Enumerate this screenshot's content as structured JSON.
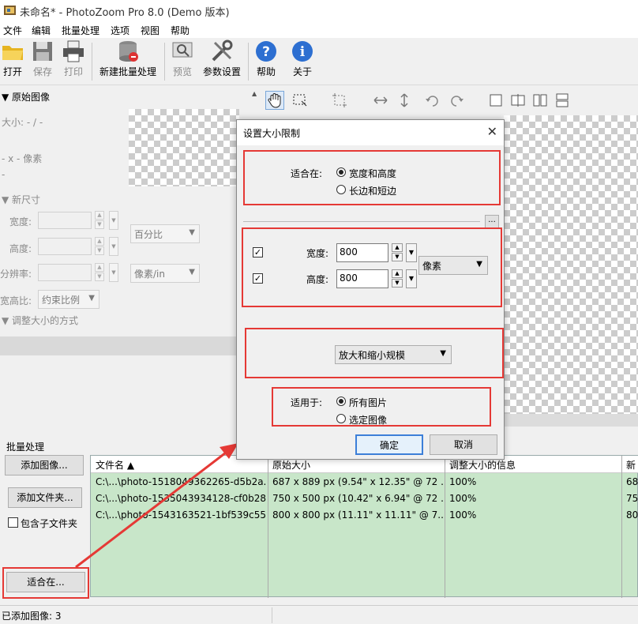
{
  "window": {
    "title": "未命名* - PhotoZoom Pro 8.0 (Demo 版本)"
  },
  "menu": [
    "文件",
    "编辑",
    "批量处理",
    "选项",
    "视图",
    "帮助"
  ],
  "toolbar": {
    "open": "打开",
    "save": "保存",
    "print": "打印",
    "new_batch": "新建批量处理",
    "preview": "预览",
    "settings": "参数设置",
    "help": "帮助",
    "about": "关于"
  },
  "left": {
    "original_header": "▼ 原始图像",
    "size_line": "大小: - / -",
    "px_line": "- x - 像素",
    "dash": "-",
    "new_size_header": "▼ 新尺寸",
    "width_label": "宽度:",
    "height_label": "高度:",
    "resolution_label": "分辨率:",
    "ratio_label": "宽高比:",
    "unit_combo": "百分比",
    "res_combo": "像素/in",
    "ratio_combo": "约束比例",
    "method_header": "▼ 调整大小的方式"
  },
  "batch": {
    "label": "批量处理",
    "add_images": "添加图像...",
    "add_folder": "添加文件夹...",
    "include_subfolders": "包含子文件夹",
    "fit_in": "适合在..."
  },
  "table": {
    "headers": [
      "文件名 ▲",
      "原始大小",
      "调整大小的信息",
      "新"
    ],
    "rows": [
      [
        "C:\\...\\photo-1518049362265-d5b2a...",
        "687 x 889 px (9.54\" x 12.35\" @ 72 ...",
        "100%",
        "68"
      ],
      [
        "C:\\...\\photo-1535043934128-cf0b28...",
        "750 x 500 px (10.42\" x 6.94\" @ 72 ...",
        "100%",
        "75"
      ],
      [
        "C:\\...\\photo-1543163521-1bf539c55...",
        "800 x 800 px (11.11\" x 11.11\" @ 7...",
        "100%",
        "80"
      ]
    ]
  },
  "status": {
    "text": "已添加图像: 3"
  },
  "dialog": {
    "title": "设置大小限制",
    "close": "✕",
    "fit_label": "适合在:",
    "fit_option1": "宽度和高度",
    "fit_option2": "长边和短边",
    "more": "...",
    "width_label": "宽度:",
    "width_value": "800",
    "height_label": "高度:",
    "height_value": "800",
    "unit": "像素",
    "scale_mode": "放大和缩小规模",
    "apply_label": "适用于:",
    "apply_option1": "所有图片",
    "apply_option2": "选定图像",
    "ok": "确定",
    "cancel": "取消"
  },
  "colors": {
    "highlight": "#e53935",
    "table_bg": "#c8e6c9",
    "accent": "#3c7fd8"
  }
}
